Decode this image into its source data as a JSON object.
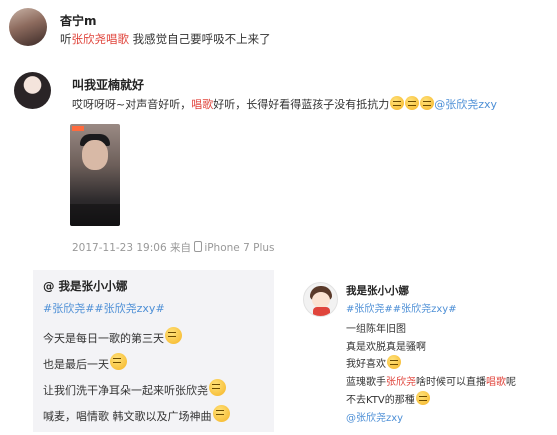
{
  "post1": {
    "username": "杳宁m",
    "text_prefix": "听",
    "mention": "张欣尧",
    "highlight": "唱歌",
    "text_suffix": " 我感觉自己要呼吸不上来了"
  },
  "post2": {
    "username": "叫我亚楠就好",
    "text_part1": "哎呀呀呀~对声音好听，",
    "highlight": "唱歌",
    "text_part2": "好听，长得好看得蓝孩子没有抵抗力",
    "mention": "@张欣尧zxy",
    "meta_date": "2017-11-23 19:06",
    "meta_from": " 来自 ",
    "meta_device": "iPhone 7 Plus"
  },
  "card_left": {
    "username": "@ 我是张小小娜",
    "tags": "#张欣尧##张欣尧zxy#",
    "line1": "今天是每日一歌的第三天",
    "line2": "也是最后一天",
    "line3": "让我们洗干净耳朵一起来听张欣尧",
    "line4": "喊麦，唱情歌 韩文歌以及广场神曲"
  },
  "card_right": {
    "username": "我是张小小娜",
    "tags": "#张欣尧##张欣尧zxy#",
    "line1": "一组陈年旧图",
    "line2": "真是欢脱真是骚啊",
    "line3": "我好喜欢",
    "line4_prefix": "蓝瑰歌手",
    "line4_mention": "张欣尧",
    "line4_mid": "啥时候可以直播",
    "line4_highlight": "唱歌",
    "line4_suffix": "呢",
    "line5": "不去KTV的那種",
    "mention": "@张欣尧zxy"
  },
  "colors": {
    "mention": "#e0453c",
    "tag": "#4d8fd6",
    "card_bg": "#f3f3f6"
  }
}
